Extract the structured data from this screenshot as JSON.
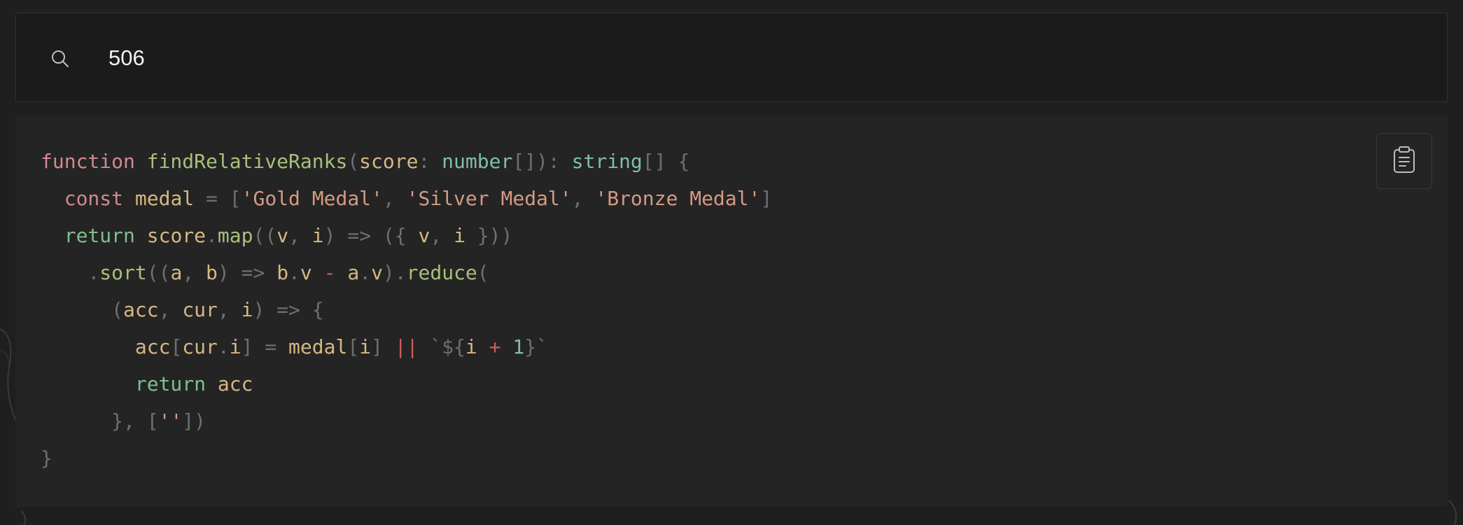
{
  "search": {
    "value": "506",
    "icon": "search-icon"
  },
  "code": {
    "language": "typescript",
    "lines": [
      [
        [
          "kw",
          "function"
        ],
        [
          "pl",
          " "
        ],
        [
          "fn",
          "findRelativeRanks"
        ],
        [
          "pu",
          "("
        ],
        [
          "id",
          "score"
        ],
        [
          "pu",
          ": "
        ],
        [
          "ty",
          "number"
        ],
        [
          "pu",
          "[]): "
        ],
        [
          "ty",
          "string"
        ],
        [
          "pu",
          "[] {"
        ]
      ],
      [
        [
          "pl",
          "  "
        ],
        [
          "kw",
          "const"
        ],
        [
          "pl",
          " "
        ],
        [
          "id",
          "medal"
        ],
        [
          "pl",
          " "
        ],
        [
          "pu",
          "= ["
        ],
        [
          "st",
          "'Gold Medal'"
        ],
        [
          "pu",
          ", "
        ],
        [
          "st",
          "'Silver Medal'"
        ],
        [
          "pu",
          ", "
        ],
        [
          "st",
          "'Bronze Medal'"
        ],
        [
          "pu",
          "]"
        ]
      ],
      [
        [
          "pl",
          "  "
        ],
        [
          "rt",
          "return"
        ],
        [
          "pl",
          " "
        ],
        [
          "id",
          "score"
        ],
        [
          "pu",
          "."
        ],
        [
          "fn",
          "map"
        ],
        [
          "pu",
          "(("
        ],
        [
          "id",
          "v"
        ],
        [
          "pu",
          ", "
        ],
        [
          "id",
          "i"
        ],
        [
          "pu",
          ") => ({ "
        ],
        [
          "id",
          "v"
        ],
        [
          "pu",
          ", "
        ],
        [
          "id",
          "i"
        ],
        [
          "pu",
          " }))"
        ]
      ],
      [
        [
          "pl",
          "    "
        ],
        [
          "pu",
          "."
        ],
        [
          "fn",
          "sort"
        ],
        [
          "pu",
          "(("
        ],
        [
          "id",
          "a"
        ],
        [
          "pu",
          ", "
        ],
        [
          "id",
          "b"
        ],
        [
          "pu",
          ") => "
        ],
        [
          "id",
          "b"
        ],
        [
          "pu",
          "."
        ],
        [
          "id",
          "v"
        ],
        [
          "pl",
          " "
        ],
        [
          "op",
          "-"
        ],
        [
          "pl",
          " "
        ],
        [
          "id",
          "a"
        ],
        [
          "pu",
          "."
        ],
        [
          "id",
          "v"
        ],
        [
          "pu",
          ")."
        ],
        [
          "fn",
          "reduce"
        ],
        [
          "pu",
          "("
        ]
      ],
      [
        [
          "pl",
          "      "
        ],
        [
          "pu",
          "("
        ],
        [
          "id",
          "acc"
        ],
        [
          "pu",
          ", "
        ],
        [
          "id",
          "cur"
        ],
        [
          "pu",
          ", "
        ],
        [
          "id",
          "i"
        ],
        [
          "pu",
          ") => {"
        ]
      ],
      [
        [
          "pl",
          "        "
        ],
        [
          "id",
          "acc"
        ],
        [
          "pu",
          "["
        ],
        [
          "id",
          "cur"
        ],
        [
          "pu",
          "."
        ],
        [
          "id",
          "i"
        ],
        [
          "pu",
          "] = "
        ],
        [
          "id",
          "medal"
        ],
        [
          "pu",
          "["
        ],
        [
          "id",
          "i"
        ],
        [
          "pu",
          "] "
        ],
        [
          "op",
          "||"
        ],
        [
          "pl",
          " "
        ],
        [
          "pu",
          "`${"
        ],
        [
          "id",
          "i"
        ],
        [
          "pl",
          " "
        ],
        [
          "op",
          "+"
        ],
        [
          "pl",
          " "
        ],
        [
          "nu",
          "1"
        ],
        [
          "pu",
          "}`"
        ]
      ],
      [
        [
          "pl",
          "        "
        ],
        [
          "rt",
          "return"
        ],
        [
          "pl",
          " "
        ],
        [
          "id",
          "acc"
        ]
      ],
      [
        [
          "pl",
          "      "
        ],
        [
          "pu",
          "}, ["
        ],
        [
          "st",
          "''"
        ],
        [
          "pu",
          "])"
        ]
      ],
      [
        [
          "pu",
          "}"
        ]
      ]
    ]
  },
  "copy_button": {
    "icon": "clipboard-icon"
  },
  "colors": {
    "background": "#1f1f1f",
    "search_bg": "#1b1b1b",
    "search_border": "#26324a",
    "code_bg": "#242424",
    "keyword": "#d08a8e",
    "function": "#a8c079",
    "identifier": "#d7b783",
    "type": "#7fbfa6",
    "punctuation": "#6f6f6f",
    "string": "#d49a82",
    "operator": "#d05a5a"
  }
}
